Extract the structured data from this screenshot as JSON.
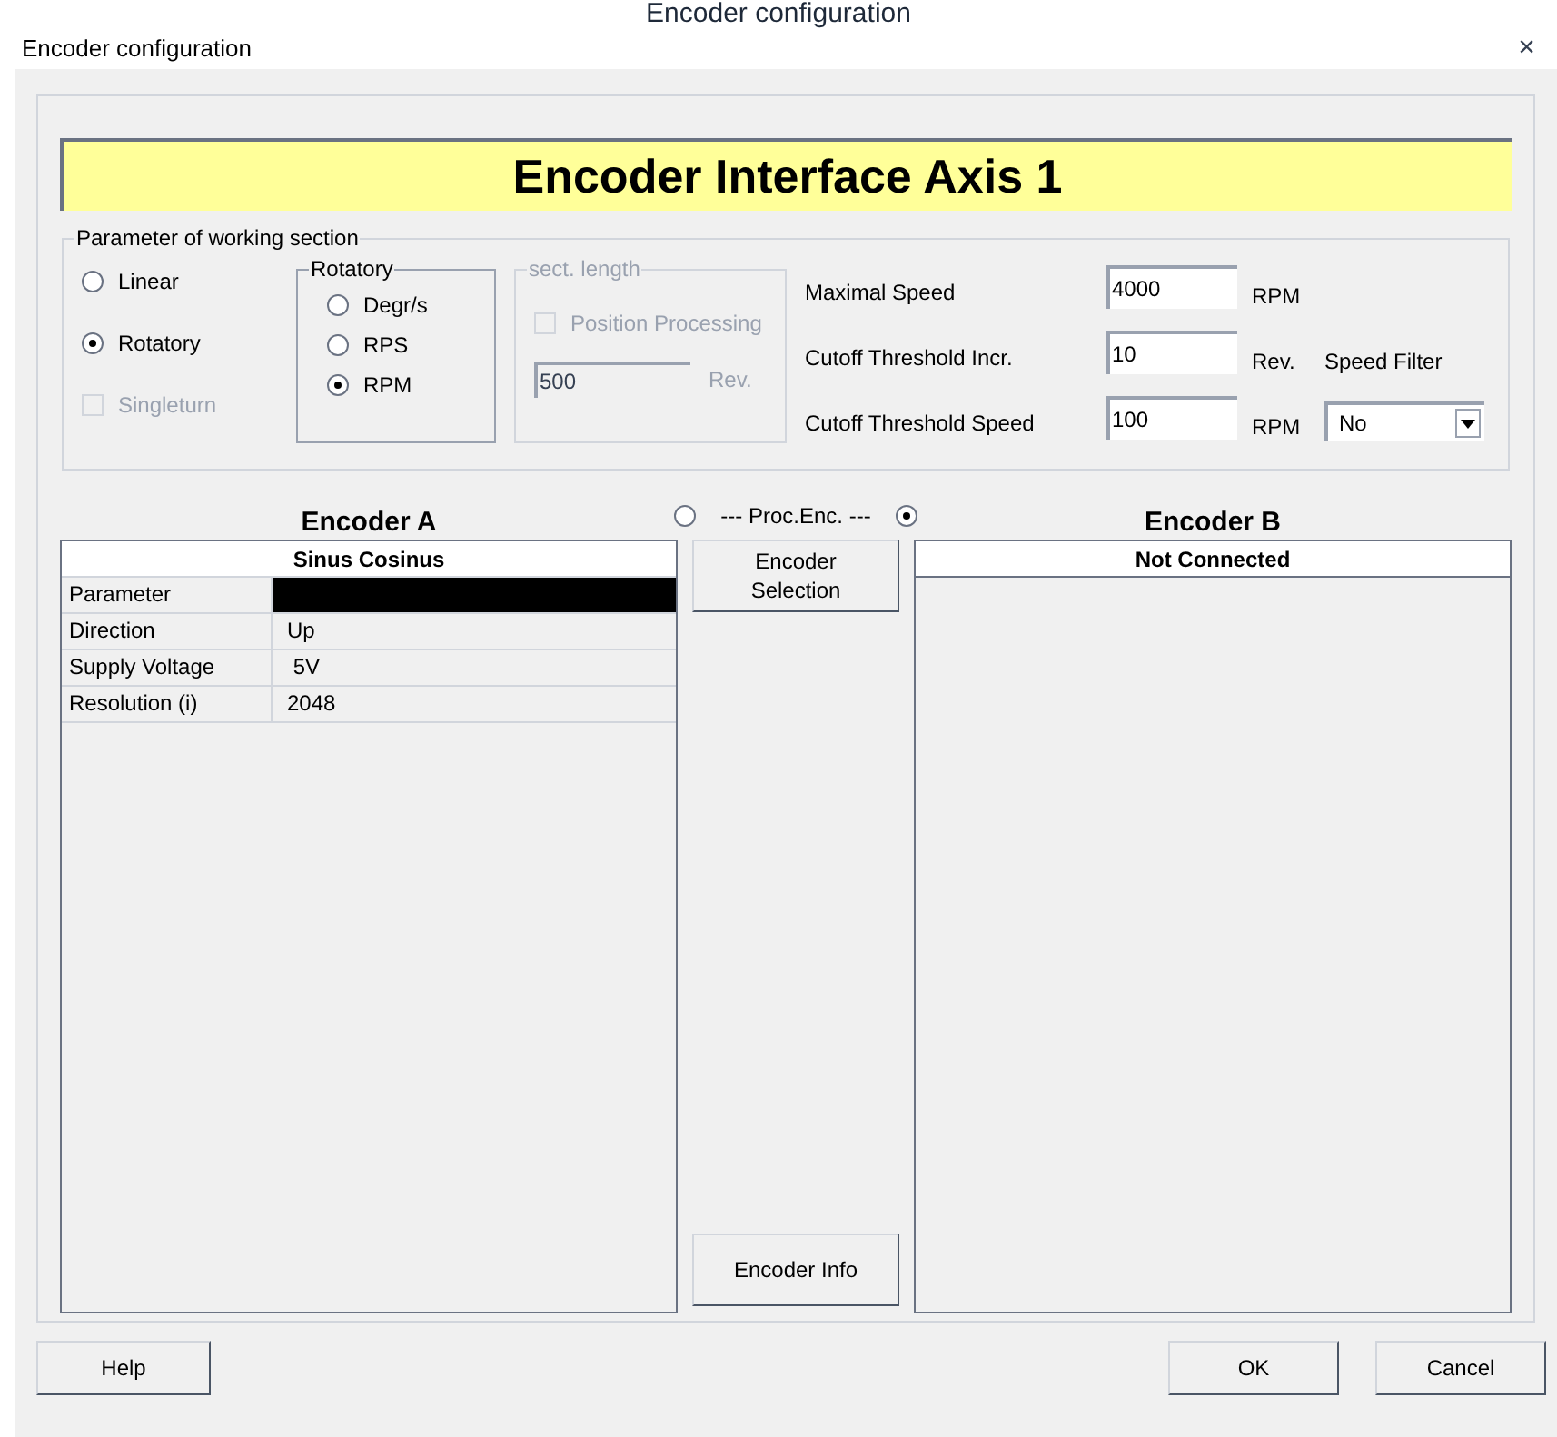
{
  "caption": "Encoder configuration",
  "window": {
    "title": "Encoder configuration",
    "close": "×"
  },
  "banner": "Encoder Interface Axis 1",
  "working_section": {
    "legend": "Parameter of working section",
    "mode": [
      {
        "label": "Linear",
        "selected": false
      },
      {
        "label": "Rotatory",
        "selected": true
      }
    ],
    "singleturn": {
      "label": "Singleturn",
      "checked": false,
      "disabled": true
    },
    "rotatory": {
      "legend": "Rotatory",
      "units": [
        {
          "label": "Degr/s",
          "selected": false
        },
        {
          "label": "RPS",
          "selected": false
        },
        {
          "label": "RPM",
          "selected": true
        }
      ]
    },
    "sect_length": {
      "legend": "sect. length",
      "disabled": true,
      "position_processing": {
        "label": "Position Processing",
        "checked": false
      },
      "value": "500",
      "unit": "Rev."
    },
    "params": [
      {
        "label": "Maximal Speed",
        "value": "4000",
        "unit": "RPM"
      },
      {
        "label": "Cutoff Threshold Incr.",
        "value": "10",
        "unit": "Rev."
      },
      {
        "label": "Cutoff Threshold Speed",
        "value": "100",
        "unit": "RPM"
      }
    ],
    "speed_filter": {
      "label": "Speed Filter",
      "value": "No"
    }
  },
  "proc_enc": {
    "label": "--- Proc.Enc. ---",
    "options": [
      {
        "selected": false
      },
      {
        "selected": true
      }
    ]
  },
  "encoder_a": {
    "title": "Encoder A",
    "header": "Sinus Cosinus",
    "rows": [
      {
        "name": "Parameter",
        "selected": true
      },
      {
        "name": "Direction",
        "value": "Up",
        "selected": false
      },
      {
        "name": "Supply Voltage",
        "value": " 5V",
        "selected": false
      },
      {
        "name": "Resolution (i)",
        "value": "2048",
        "selected": false
      }
    ]
  },
  "encoder_b": {
    "title": "Encoder B",
    "header": "Not Connected"
  },
  "middle_buttons": [
    "Encoder Selection",
    "Encoder Info"
  ],
  "footer": {
    "help": "Help",
    "ok": "OK",
    "cancel": "Cancel"
  }
}
